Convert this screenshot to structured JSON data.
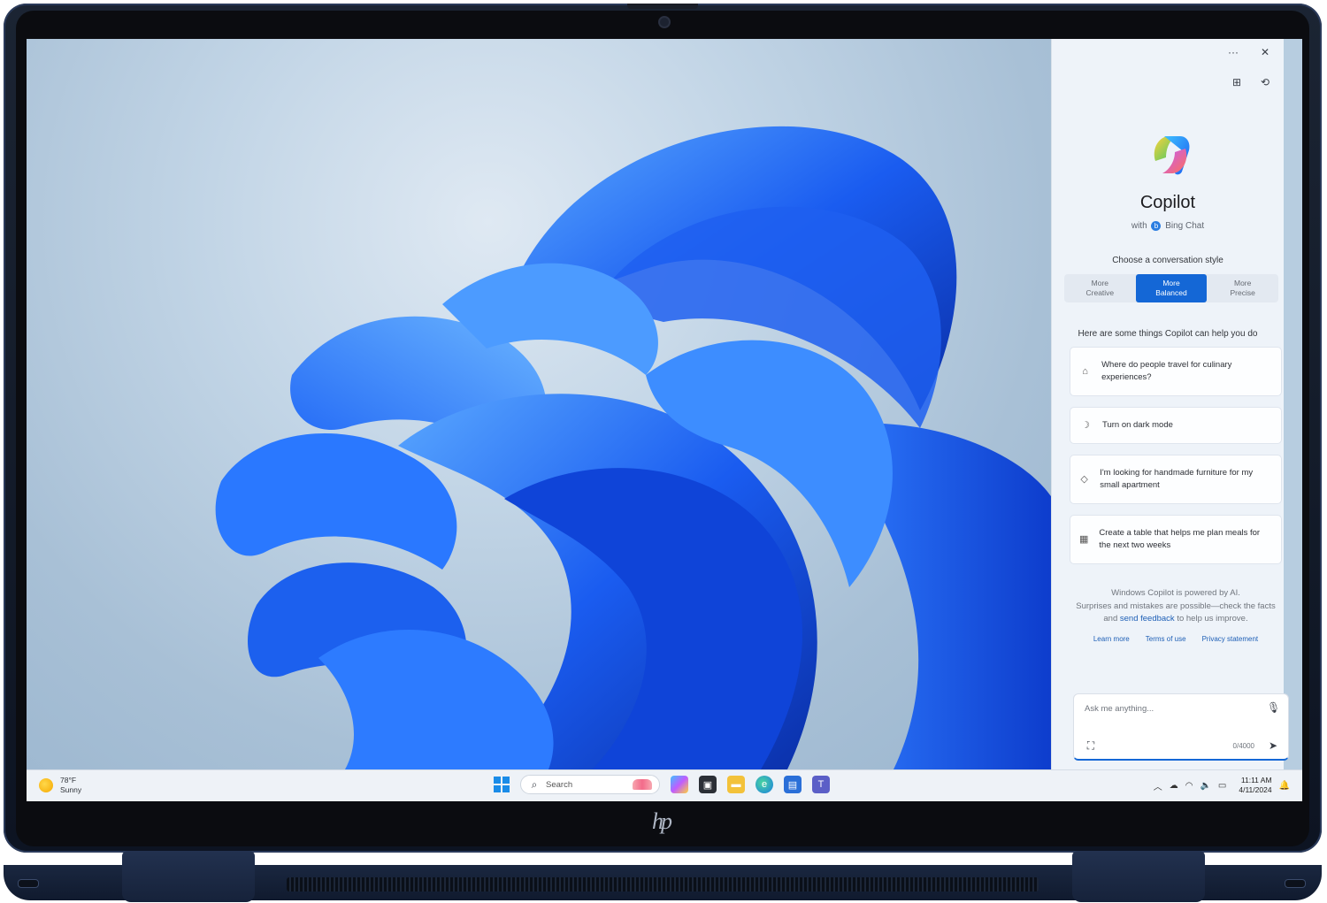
{
  "copilot": {
    "title": "Copilot",
    "subtitle_prefix": "with",
    "subtitle_brand": "Bing Chat",
    "choose_style": "Choose a conversation style",
    "styles": [
      {
        "line1": "More",
        "line2": "Creative",
        "active": false
      },
      {
        "line1": "More",
        "line2": "Balanced",
        "active": true
      },
      {
        "line1": "More",
        "line2": "Precise",
        "active": false
      }
    ],
    "help_heading": "Here are some things Copilot can help you do",
    "suggestions": [
      {
        "icon": "bag-icon",
        "text": "Where do people travel for culinary experiences?"
      },
      {
        "icon": "moon-icon",
        "text": "Turn on dark mode"
      },
      {
        "icon": "tag-icon",
        "text": "I'm looking for handmade furniture for my small apartment"
      },
      {
        "icon": "table-icon",
        "text": "Create a table that helps me plan meals for the next two weeks"
      }
    ],
    "disclaimer_1": "Windows Copilot is powered by AI.",
    "disclaimer_2": "Surprises and mistakes are possible—check the facts and ",
    "disclaimer_link": "send feedback",
    "disclaimer_3": " to help us improve.",
    "links": [
      "Learn more",
      "Terms of use",
      "Privacy statement"
    ],
    "input_placeholder": "Ask me anything...",
    "char_count": "0/4000",
    "accent_color": "#1467d6"
  },
  "taskbar": {
    "weather_temp": "78°F",
    "weather_desc": "Sunny",
    "search_label": "Search",
    "time": "11:11 AM",
    "date": "4/11/2024"
  },
  "device": {
    "brand_logo": "hp"
  }
}
